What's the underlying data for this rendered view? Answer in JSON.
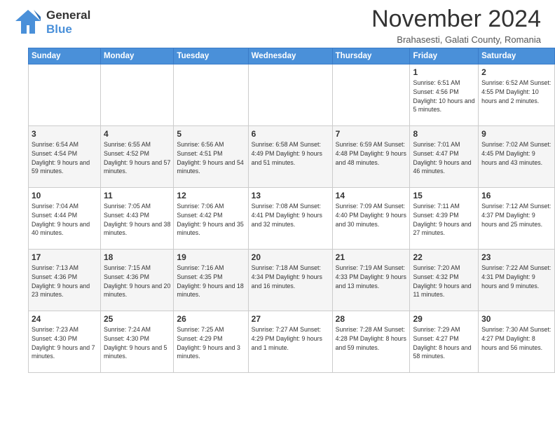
{
  "header": {
    "logo_line1": "General",
    "logo_line2": "Blue",
    "title": "November 2024",
    "subtitle": "Brahasesti, Galati County, Romania"
  },
  "weekdays": [
    "Sunday",
    "Monday",
    "Tuesday",
    "Wednesday",
    "Thursday",
    "Friday",
    "Saturday"
  ],
  "weeks": [
    [
      {
        "day": "",
        "info": ""
      },
      {
        "day": "",
        "info": ""
      },
      {
        "day": "",
        "info": ""
      },
      {
        "day": "",
        "info": ""
      },
      {
        "day": "",
        "info": ""
      },
      {
        "day": "1",
        "info": "Sunrise: 6:51 AM\nSunset: 4:56 PM\nDaylight: 10 hours\nand 5 minutes."
      },
      {
        "day": "2",
        "info": "Sunrise: 6:52 AM\nSunset: 4:55 PM\nDaylight: 10 hours\nand 2 minutes."
      }
    ],
    [
      {
        "day": "3",
        "info": "Sunrise: 6:54 AM\nSunset: 4:54 PM\nDaylight: 9 hours\nand 59 minutes."
      },
      {
        "day": "4",
        "info": "Sunrise: 6:55 AM\nSunset: 4:52 PM\nDaylight: 9 hours\nand 57 minutes."
      },
      {
        "day": "5",
        "info": "Sunrise: 6:56 AM\nSunset: 4:51 PM\nDaylight: 9 hours\nand 54 minutes."
      },
      {
        "day": "6",
        "info": "Sunrise: 6:58 AM\nSunset: 4:49 PM\nDaylight: 9 hours\nand 51 minutes."
      },
      {
        "day": "7",
        "info": "Sunrise: 6:59 AM\nSunset: 4:48 PM\nDaylight: 9 hours\nand 48 minutes."
      },
      {
        "day": "8",
        "info": "Sunrise: 7:01 AM\nSunset: 4:47 PM\nDaylight: 9 hours\nand 46 minutes."
      },
      {
        "day": "9",
        "info": "Sunrise: 7:02 AM\nSunset: 4:45 PM\nDaylight: 9 hours\nand 43 minutes."
      }
    ],
    [
      {
        "day": "10",
        "info": "Sunrise: 7:04 AM\nSunset: 4:44 PM\nDaylight: 9 hours\nand 40 minutes."
      },
      {
        "day": "11",
        "info": "Sunrise: 7:05 AM\nSunset: 4:43 PM\nDaylight: 9 hours\nand 38 minutes."
      },
      {
        "day": "12",
        "info": "Sunrise: 7:06 AM\nSunset: 4:42 PM\nDaylight: 9 hours\nand 35 minutes."
      },
      {
        "day": "13",
        "info": "Sunrise: 7:08 AM\nSunset: 4:41 PM\nDaylight: 9 hours\nand 32 minutes."
      },
      {
        "day": "14",
        "info": "Sunrise: 7:09 AM\nSunset: 4:40 PM\nDaylight: 9 hours\nand 30 minutes."
      },
      {
        "day": "15",
        "info": "Sunrise: 7:11 AM\nSunset: 4:39 PM\nDaylight: 9 hours\nand 27 minutes."
      },
      {
        "day": "16",
        "info": "Sunrise: 7:12 AM\nSunset: 4:37 PM\nDaylight: 9 hours\nand 25 minutes."
      }
    ],
    [
      {
        "day": "17",
        "info": "Sunrise: 7:13 AM\nSunset: 4:36 PM\nDaylight: 9 hours\nand 23 minutes."
      },
      {
        "day": "18",
        "info": "Sunrise: 7:15 AM\nSunset: 4:36 PM\nDaylight: 9 hours\nand 20 minutes."
      },
      {
        "day": "19",
        "info": "Sunrise: 7:16 AM\nSunset: 4:35 PM\nDaylight: 9 hours\nand 18 minutes."
      },
      {
        "day": "20",
        "info": "Sunrise: 7:18 AM\nSunset: 4:34 PM\nDaylight: 9 hours\nand 16 minutes."
      },
      {
        "day": "21",
        "info": "Sunrise: 7:19 AM\nSunset: 4:33 PM\nDaylight: 9 hours\nand 13 minutes."
      },
      {
        "day": "22",
        "info": "Sunrise: 7:20 AM\nSunset: 4:32 PM\nDaylight: 9 hours\nand 11 minutes."
      },
      {
        "day": "23",
        "info": "Sunrise: 7:22 AM\nSunset: 4:31 PM\nDaylight: 9 hours\nand 9 minutes."
      }
    ],
    [
      {
        "day": "24",
        "info": "Sunrise: 7:23 AM\nSunset: 4:30 PM\nDaylight: 9 hours\nand 7 minutes."
      },
      {
        "day": "25",
        "info": "Sunrise: 7:24 AM\nSunset: 4:30 PM\nDaylight: 9 hours\nand 5 minutes."
      },
      {
        "day": "26",
        "info": "Sunrise: 7:25 AM\nSunset: 4:29 PM\nDaylight: 9 hours\nand 3 minutes."
      },
      {
        "day": "27",
        "info": "Sunrise: 7:27 AM\nSunset: 4:29 PM\nDaylight: 9 hours\nand 1 minute."
      },
      {
        "day": "28",
        "info": "Sunrise: 7:28 AM\nSunset: 4:28 PM\nDaylight: 8 hours\nand 59 minutes."
      },
      {
        "day": "29",
        "info": "Sunrise: 7:29 AM\nSunset: 4:27 PM\nDaylight: 8 hours\nand 58 minutes."
      },
      {
        "day": "30",
        "info": "Sunrise: 7:30 AM\nSunset: 4:27 PM\nDaylight: 8 hours\nand 56 minutes."
      }
    ]
  ]
}
